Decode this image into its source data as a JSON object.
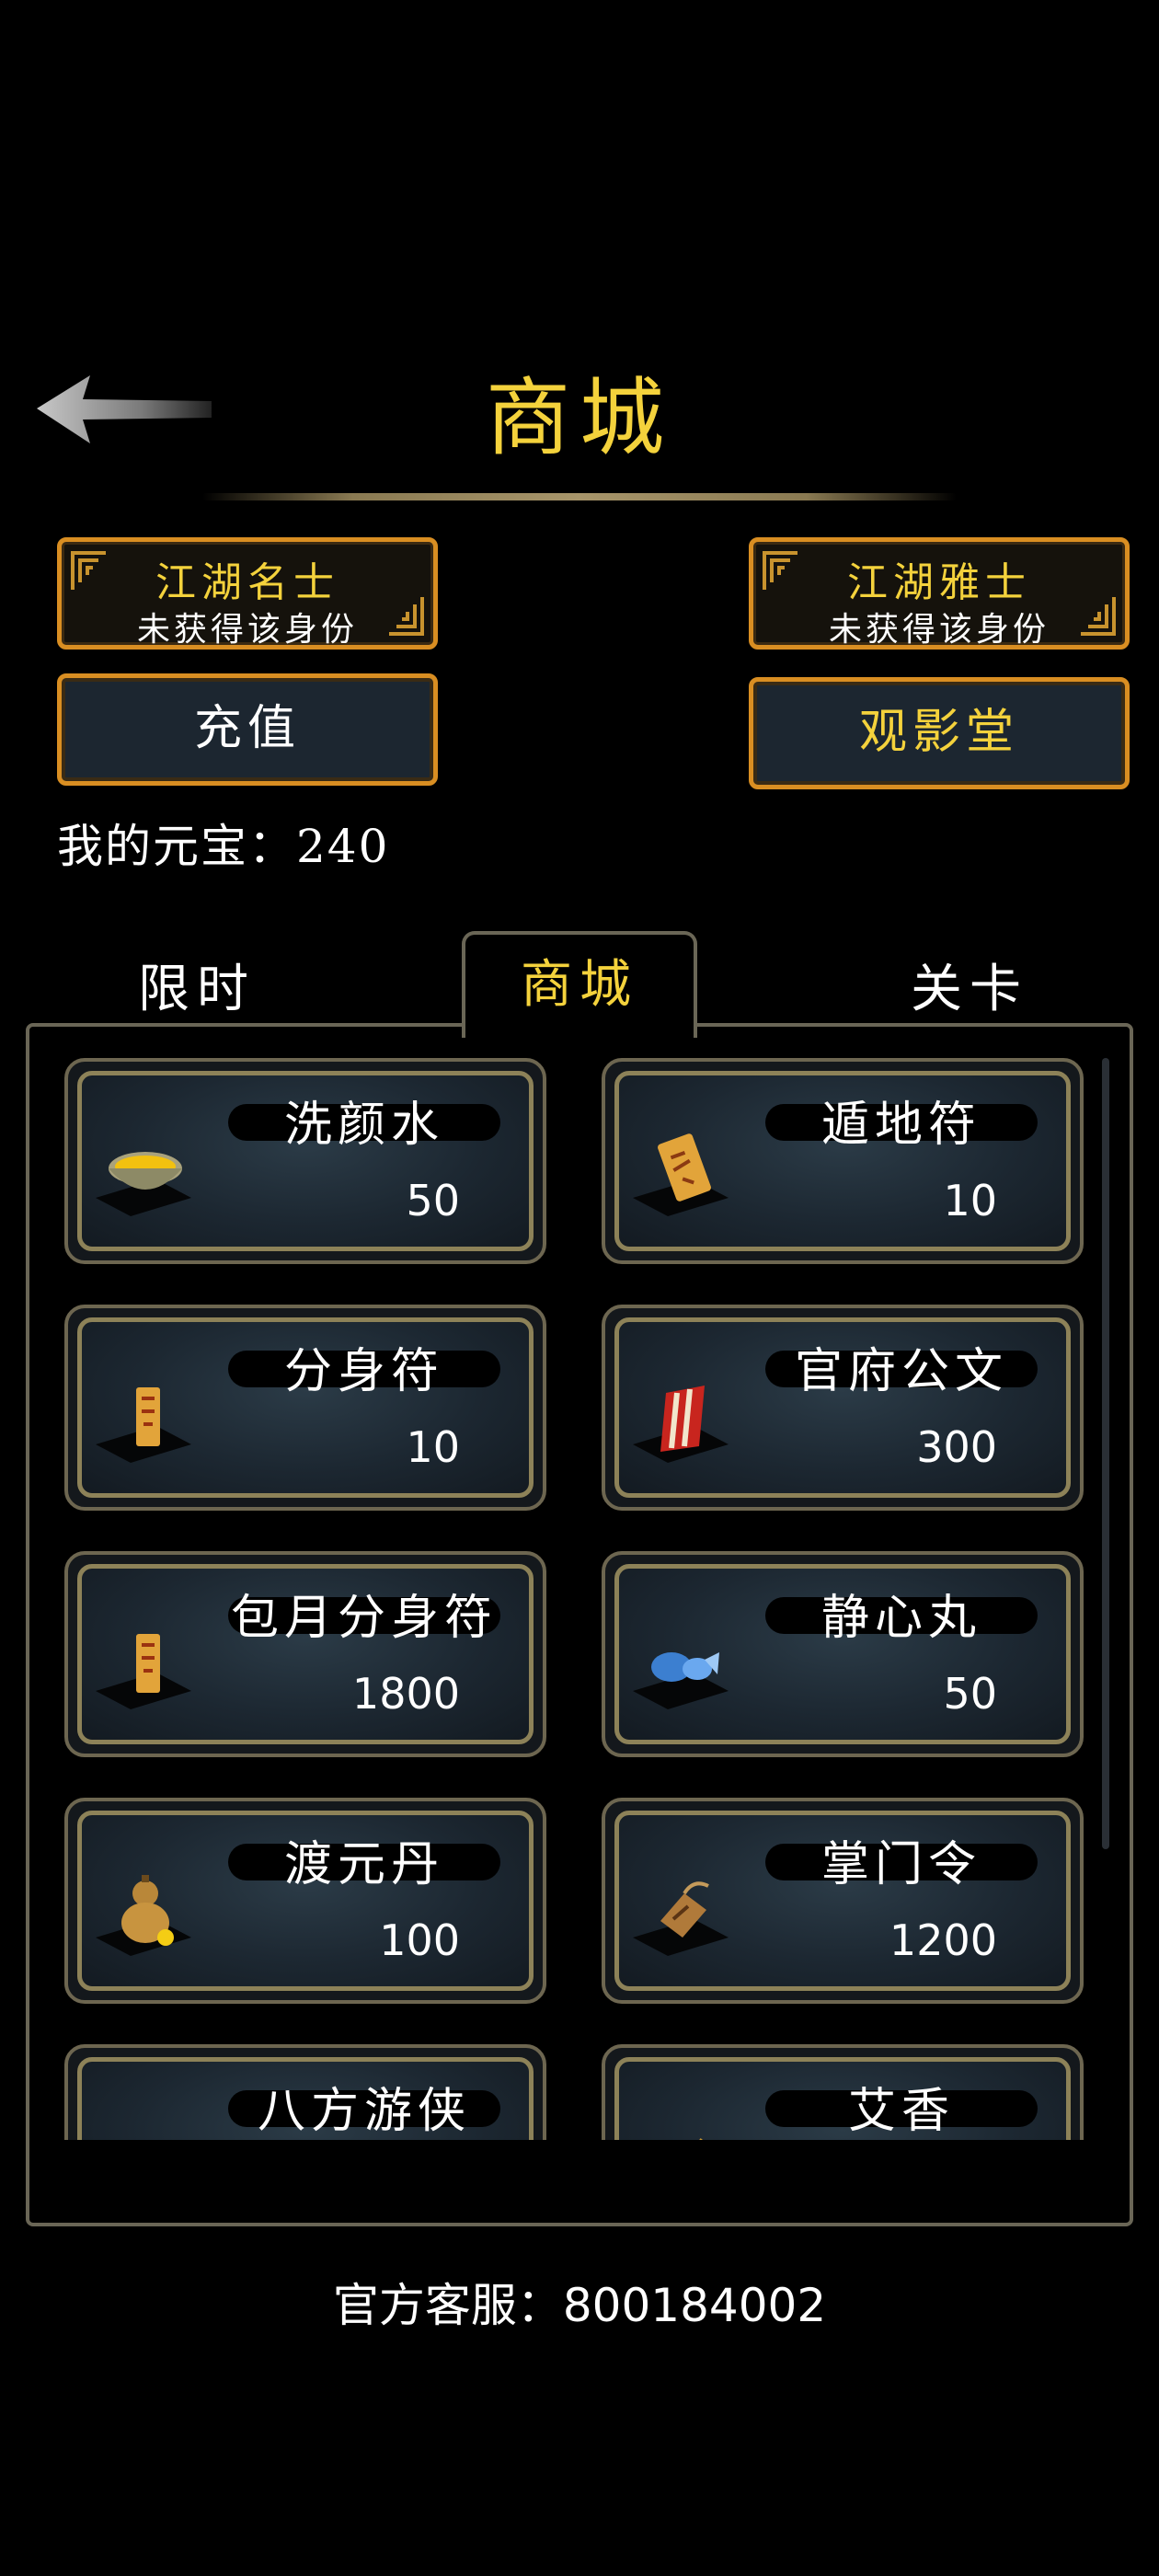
{
  "header": {
    "title": "商城"
  },
  "badges": [
    {
      "name": "江湖名士",
      "status": "未获得该身份"
    },
    {
      "name": "江湖雅士",
      "status": "未获得该身份"
    }
  ],
  "buttons": {
    "recharge": "充值",
    "cinema": "观影堂"
  },
  "wallet": {
    "label": "我的元宝：240"
  },
  "tabs": {
    "limited": "限时",
    "shop": "商城",
    "levels": "关卡",
    "active": "商城"
  },
  "items": [
    {
      "name": "洗颜水",
      "price": "50",
      "icon": "bowl-icon"
    },
    {
      "name": "遁地符",
      "price": "10",
      "icon": "talisman-icon"
    },
    {
      "name": "分身符",
      "price": "10",
      "icon": "talisman-icon"
    },
    {
      "name": "官府公文",
      "price": "300",
      "icon": "document-icon"
    },
    {
      "name": "包月分身符",
      "price": "1800",
      "icon": "talisman-icon"
    },
    {
      "name": "静心丸",
      "price": "50",
      "icon": "pill-icon"
    },
    {
      "name": "渡元丹",
      "price": "100",
      "icon": "gourd-icon"
    },
    {
      "name": "掌门令",
      "price": "1200",
      "icon": "token-icon"
    },
    {
      "name": "八方游侠",
      "price": "",
      "icon": "charm-icon"
    },
    {
      "name": "艾香",
      "price": "",
      "icon": "incense-icon"
    }
  ],
  "footer": {
    "service": "官方客服：800184002"
  },
  "colors": {
    "accent": "#f4d23c",
    "frame": "#d98e22",
    "card_border": "#8d8258"
  }
}
